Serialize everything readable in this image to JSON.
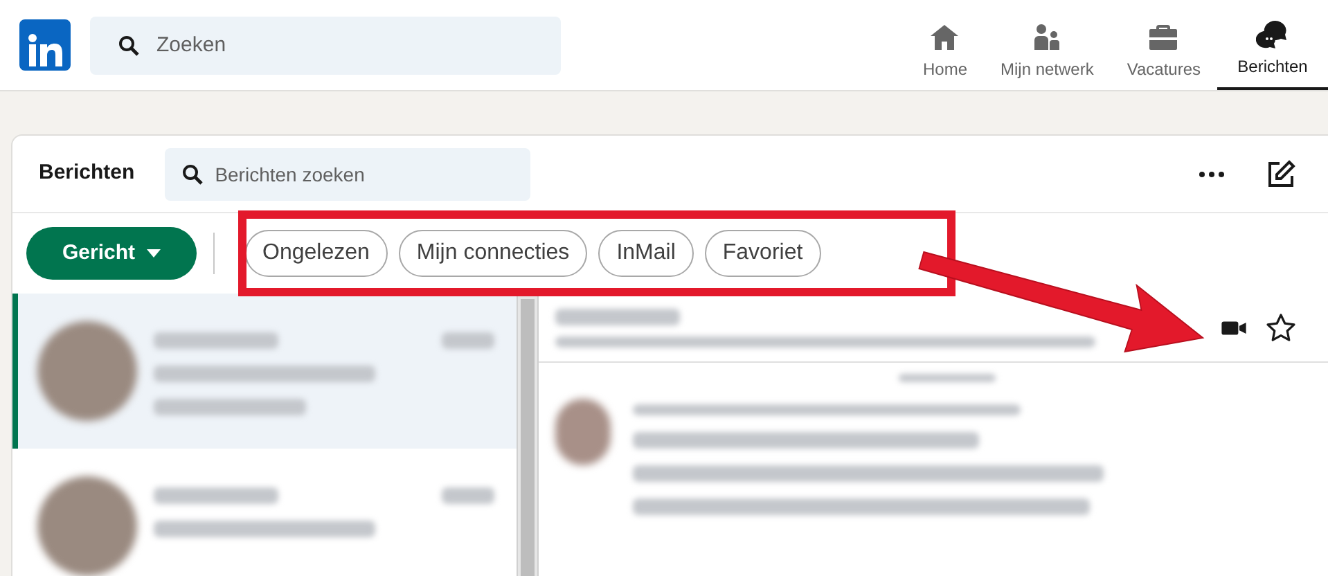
{
  "top_nav": {
    "search": {
      "placeholder": "Zoeken"
    },
    "items": [
      {
        "label": "Home",
        "kind": "home",
        "selected": false
      },
      {
        "label": "Mijn netwerk",
        "kind": "network",
        "selected": false
      },
      {
        "label": "Vacatures",
        "kind": "jobs",
        "selected": false
      },
      {
        "label": "Berichten",
        "kind": "messages",
        "selected": true
      }
    ]
  },
  "messaging": {
    "title": "Berichten",
    "search": {
      "placeholder": "Berichten zoeken"
    },
    "filter_button": "Gericht",
    "filters": [
      {
        "label": "Ongelezen",
        "selected": false
      },
      {
        "label": "Mijn connecties",
        "selected": false
      },
      {
        "label": "InMail",
        "selected": false
      },
      {
        "label": "Favoriet",
        "selected": false
      }
    ],
    "conversations": [
      {
        "selected": true
      },
      {
        "selected": false
      }
    ]
  }
}
